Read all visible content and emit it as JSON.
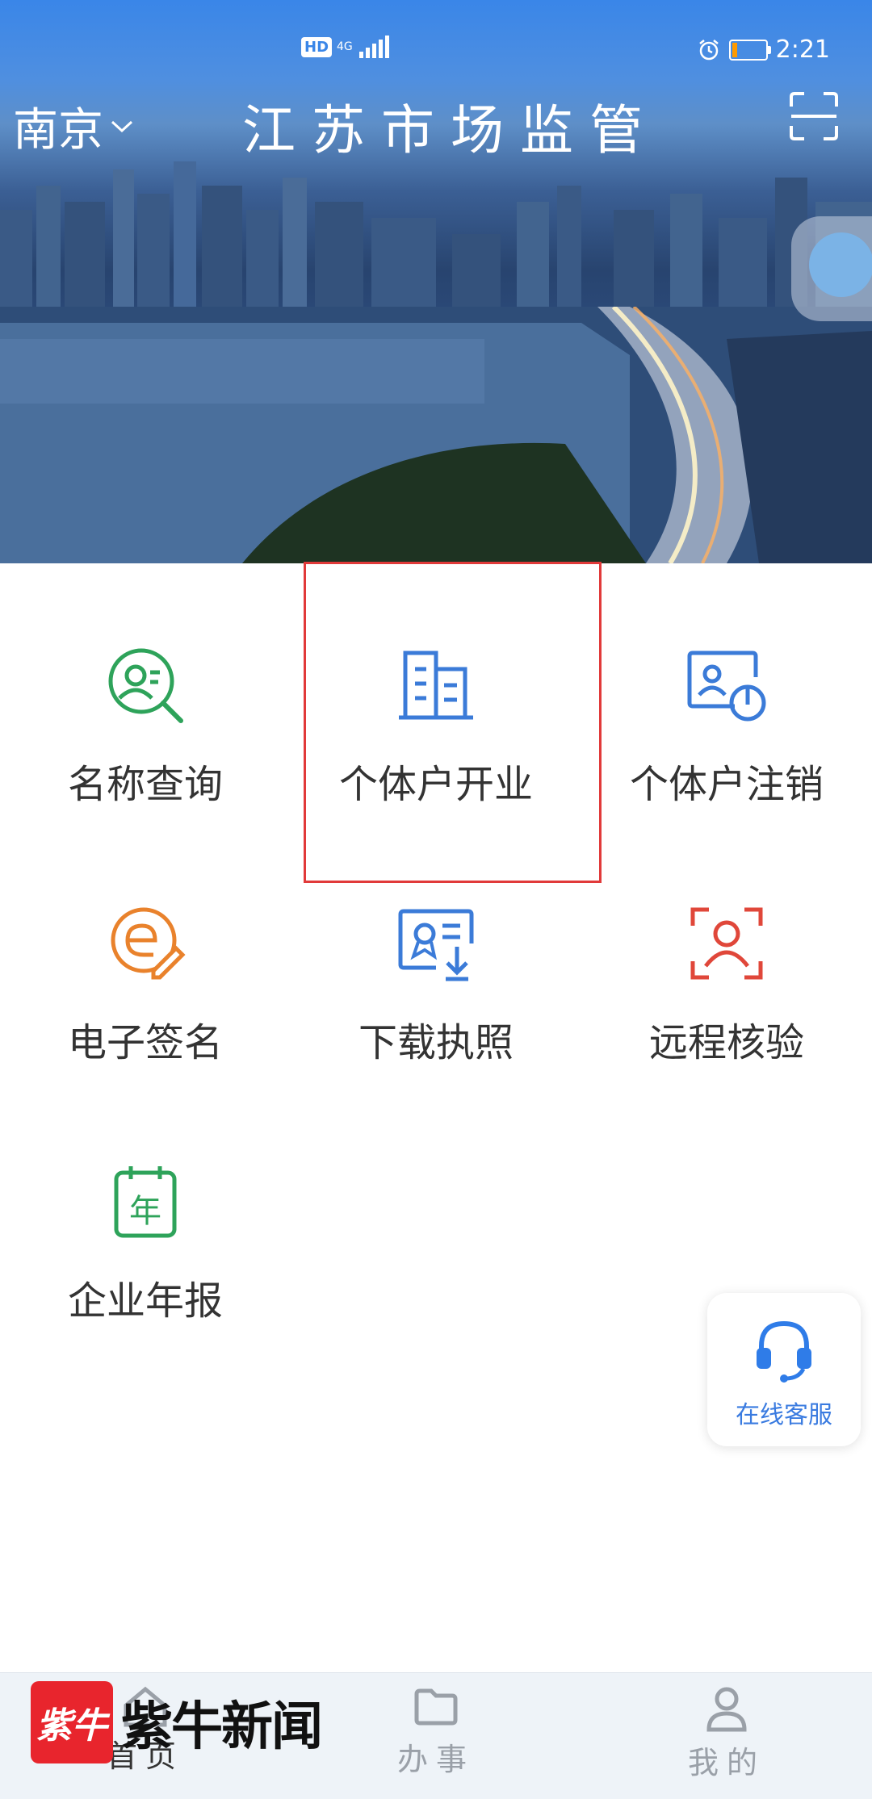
{
  "status_bar": {
    "hd": "HD",
    "network": "4G",
    "time": "2:21",
    "battery_level": 0.15
  },
  "header": {
    "city": "南京",
    "title": "江苏市场监管"
  },
  "services": [
    {
      "label": "名称查询",
      "icon": "name-search-icon",
      "color": "#2ea35a"
    },
    {
      "label": "个体户开业",
      "icon": "building-icon",
      "color": "#3b7bd8",
      "highlighted": true
    },
    {
      "label": "个体户注销",
      "icon": "power-off-card-icon",
      "color": "#3b7bd8"
    },
    {
      "label": "电子签名",
      "icon": "e-signature-icon",
      "color": "#e9822c"
    },
    {
      "label": "下载执照",
      "icon": "license-download-icon",
      "color": "#3b7bd8"
    },
    {
      "label": "远程核验",
      "icon": "face-verify-icon",
      "color": "#e0473a"
    },
    {
      "label": "企业年报",
      "icon": "annual-report-icon",
      "color": "#2ea35a",
      "badge": "年"
    }
  ],
  "online_service": {
    "label": "在线客服",
    "icon": "headset-icon"
  },
  "tabbar": {
    "items": [
      {
        "label": "首页",
        "icon": "home-icon",
        "active": true
      },
      {
        "label": "办事",
        "icon": "folder-icon"
      },
      {
        "label": "我的",
        "icon": "user-icon"
      }
    ]
  },
  "watermark": {
    "box_text": "紫牛",
    "text": "紫牛新闻"
  },
  "colors": {
    "primary": "#3a86e8",
    "highlight_border": "#e13a3a",
    "label_text": "#333333"
  }
}
